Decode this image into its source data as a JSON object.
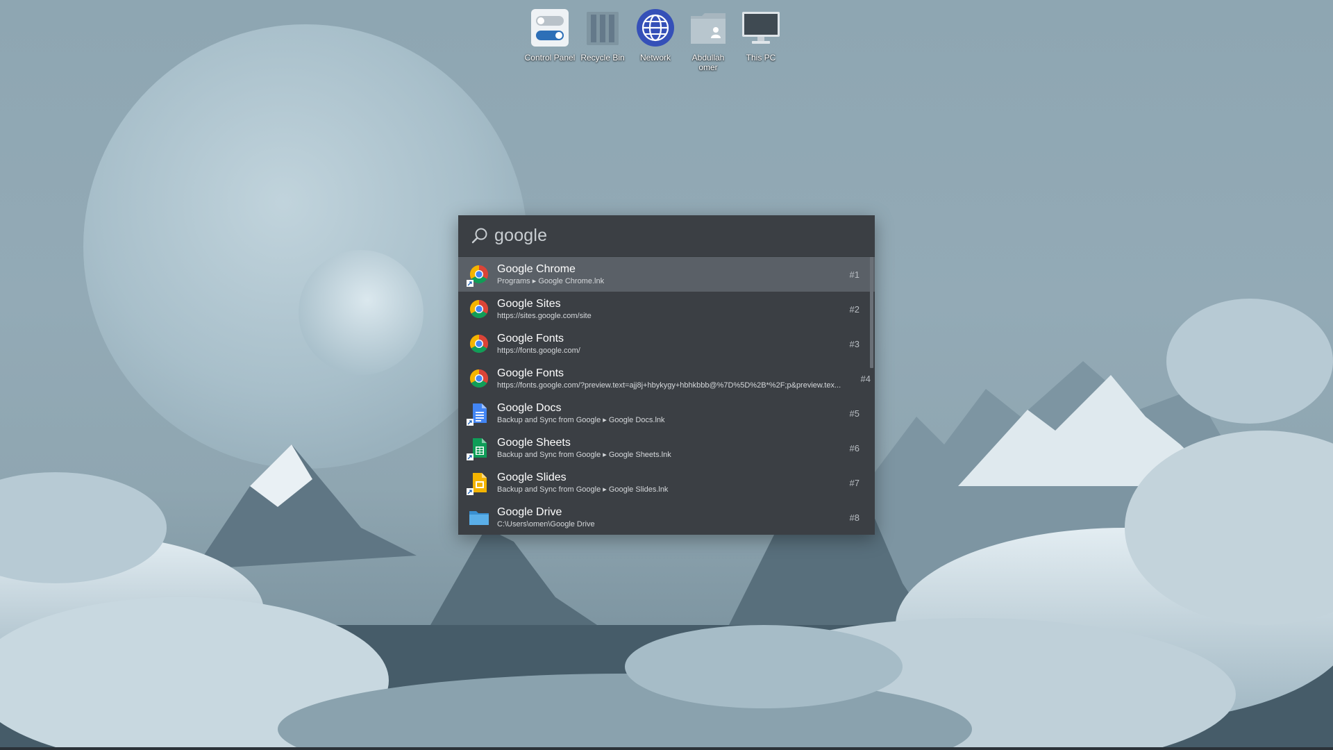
{
  "desktop": {
    "icons": [
      {
        "label": "Control Panel",
        "icon": "control-panel-icon"
      },
      {
        "label": "Recycle Bin",
        "icon": "recycle-bin-icon"
      },
      {
        "label": "Network",
        "icon": "network-icon"
      },
      {
        "label": "Abdullah omer",
        "icon": "user-folder-icon"
      },
      {
        "label": "This PC",
        "icon": "this-pc-icon"
      }
    ]
  },
  "launcher": {
    "query": "google",
    "search_icon": "search-icon",
    "results": [
      {
        "title": "Google Chrome",
        "subtitle": "Programs ▸ Google Chrome.lnk",
        "rank": "#1",
        "icon": "chrome-icon",
        "selected": true
      },
      {
        "title": "Google Sites",
        "subtitle": "https://sites.google.com/site",
        "rank": "#2",
        "icon": "chrome-icon"
      },
      {
        "title": "Google Fonts",
        "subtitle": "https://fonts.google.com/",
        "rank": "#3",
        "icon": "chrome-icon"
      },
      {
        "title": "Google Fonts",
        "subtitle": "https://fonts.google.com/?preview.text=ajj8j+hbykygy+hbhkbbb@%7D%5D%2B*%2F;p&preview.tex...",
        "rank": "#4",
        "icon": "chrome-icon"
      },
      {
        "title": "Google Docs",
        "subtitle": "Backup and Sync from Google ▸ Google Docs.lnk",
        "rank": "#5",
        "icon": "google-docs-icon"
      },
      {
        "title": "Google Sheets",
        "subtitle": "Backup and Sync from Google ▸ Google Sheets.lnk",
        "rank": "#6",
        "icon": "google-sheets-icon"
      },
      {
        "title": "Google Slides",
        "subtitle": "Backup and Sync from Google ▸ Google Slides.lnk",
        "rank": "#7",
        "icon": "google-slides-icon"
      },
      {
        "title": "Google Drive",
        "subtitle": "C:\\Users\\omen\\Google Drive",
        "rank": "#8",
        "icon": "folder-icon"
      }
    ]
  },
  "colors": {
    "launcher_bg": "#3b3f44",
    "selected_bg": "#5a6067",
    "wallpaper_sky": "#8ea6b2"
  }
}
